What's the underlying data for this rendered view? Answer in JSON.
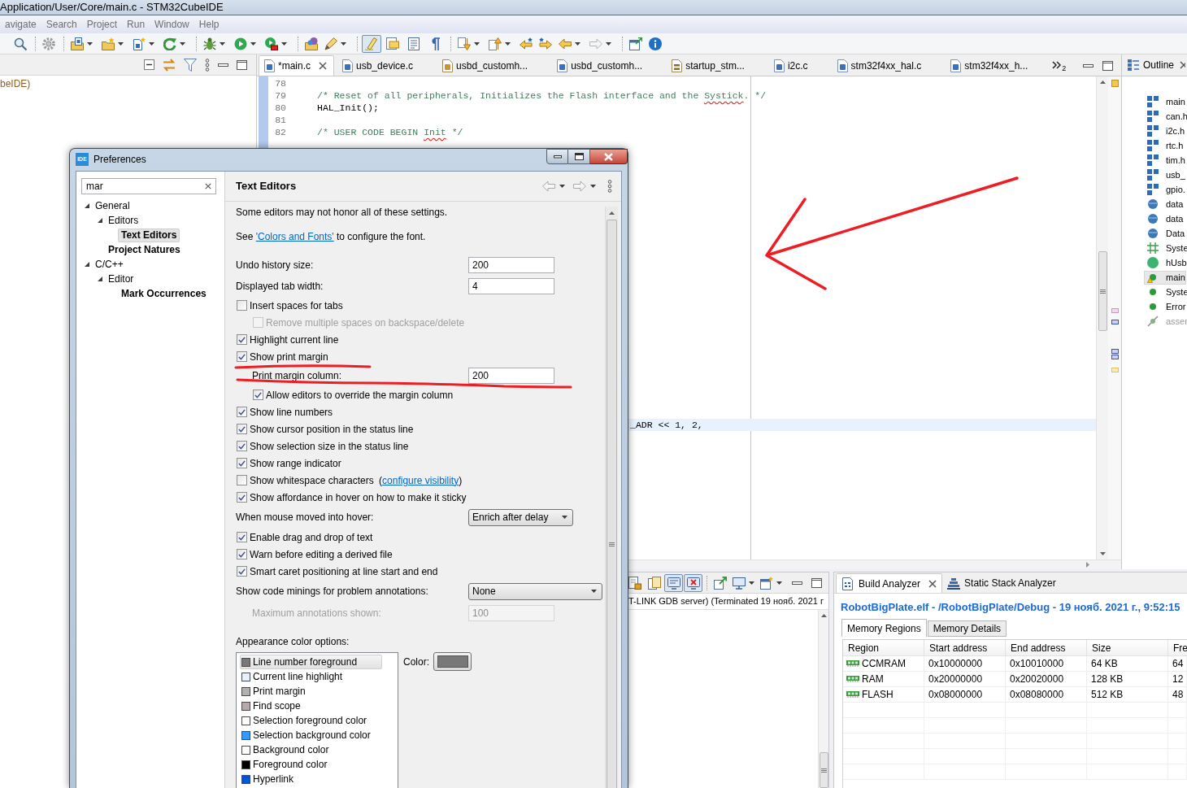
{
  "window": {
    "title": "Application/User/Core/main.c - STM32CubeIDE"
  },
  "menu": [
    "avigate",
    "Search",
    "Project",
    "Run",
    "Window",
    "Help"
  ],
  "toolbar": {
    "toggles": [
      {
        "pressed": true
      },
      {
        "pressed": false
      },
      {
        "pressed": false
      },
      {
        "pressed": false
      }
    ]
  },
  "explorer": {
    "items": [
      "beIDE)"
    ]
  },
  "editor": {
    "tabs": [
      {
        "label": "*main.c",
        "kind": "source",
        "selected": true
      },
      {
        "label": "usb_device.c",
        "kind": "source",
        "selected": false
      },
      {
        "label": "usbd_customh...",
        "kind": "header",
        "selected": false
      },
      {
        "label": "usbd_customh...",
        "kind": "source",
        "selected": false
      },
      {
        "label": "startup_stm...",
        "kind": "assembly",
        "selected": false
      },
      {
        "label": "i2c.c",
        "kind": "source",
        "selected": false
      },
      {
        "label": "stm32f4xx_hal.c",
        "kind": "source",
        "selected": false
      },
      {
        "label": "stm32f4xx_h...",
        "kind": "source",
        "selected": false
      }
    ],
    "hidden_tabs": "2",
    "lines": [
      {
        "number": "78"
      },
      {
        "number": "79",
        "kind": "comment",
        "parts": [
          {
            "text": "/* Reset of all peripherals, Initializes the Flash interface and the ",
            "misspelled": false
          },
          {
            "text": "Systick",
            "misspelled": true
          },
          {
            "text": ". */",
            "misspelled": false
          }
        ]
      },
      {
        "number": "80",
        "kind": "code",
        "parts": [
          {
            "text": "HAL_Init();",
            "misspelled": false
          }
        ]
      },
      {
        "number": "81"
      },
      {
        "number": "82",
        "kind": "comment",
        "parts": [
          {
            "text": "/* USER CODE BEGIN ",
            "misspelled": false
          },
          {
            "text": "Init",
            "misspelled": true
          },
          {
            "text": " */",
            "misspelled": false
          }
        ]
      }
    ],
    "current_line": {
      "text": "_ADR << 1, 2,"
    }
  },
  "outline": {
    "title": "Outline",
    "items": [
      {
        "label": "main",
        "kind": "include",
        "selected": false,
        "warning": false
      },
      {
        "label": "can.h",
        "kind": "include",
        "selected": false,
        "warning": false
      },
      {
        "label": "i2c.h",
        "kind": "include",
        "selected": false,
        "warning": false
      },
      {
        "label": "rtc.h",
        "kind": "include",
        "selected": false,
        "warning": false
      },
      {
        "label": "tim.h",
        "kind": "include",
        "selected": false,
        "warning": false
      },
      {
        "label": "usb_",
        "kind": "include",
        "selected": false,
        "warning": false
      },
      {
        "label": "gpio.",
        "kind": "include",
        "selected": false,
        "warning": false
      },
      {
        "label": "data",
        "kind": "field",
        "selected": false,
        "warning": false
      },
      {
        "label": "data",
        "kind": "field",
        "selected": false,
        "warning": false
      },
      {
        "label": "Data",
        "kind": "field",
        "selected": false,
        "warning": false
      },
      {
        "label": "Syste",
        "kind": "typedef",
        "selected": false,
        "warning": false
      },
      {
        "label": "hUsb",
        "kind": "variable",
        "selected": false,
        "warning": false
      },
      {
        "label": "main",
        "kind": "function",
        "selected": true,
        "warning": true
      },
      {
        "label": "Syste",
        "kind": "function",
        "selected": false,
        "warning": false
      },
      {
        "label": "Error",
        "kind": "function",
        "selected": false,
        "warning": false
      },
      {
        "label": "asser",
        "kind": "macro",
        "selected": false,
        "warning": false
      }
    ]
  },
  "console": {
    "toggles": [
      {
        "pressed": false
      },
      {
        "pressed": false
      },
      {
        "pressed": true
      },
      {
        "pressed": true
      }
    ],
    "description": "T-LINK GDB server) (Terminated 19 нояб. 2021 г"
  },
  "build_analyzer": {
    "tabs": [
      {
        "label": "Build Analyzer",
        "selected": true
      },
      {
        "label": "Static Stack Analyzer",
        "selected": false
      }
    ],
    "heading": "RobotBigPlate.elf - /RobotBigPlate/Debug - 19 нояб. 2021 г., 9:52:15",
    "subtabs": [
      {
        "label": "Memory Regions",
        "selected": true
      },
      {
        "label": "Memory Details",
        "selected": false
      }
    ],
    "table": {
      "columns": [
        "Region",
        "Start address",
        "End address",
        "Size",
        "Fre"
      ],
      "rows": [
        [
          "CCMRAM",
          "0x10000000",
          "0x10010000",
          "64 KB",
          "64"
        ],
        [
          "RAM",
          "0x20000000",
          "0x20020000",
          "128 KB",
          "12"
        ],
        [
          "FLASH",
          "0x08000000",
          "0x08080000",
          "512 KB",
          "48"
        ]
      ]
    }
  },
  "preferences": {
    "icon_label": "IDE",
    "title": "Preferences",
    "filter": "mar",
    "tree": [
      {
        "label": "General",
        "expanded": true,
        "selected": false,
        "match": false,
        "children": [
          {
            "label": "Editors",
            "expanded": true,
            "selected": false,
            "match": false,
            "children": [
              {
                "label": "Text Editors",
                "selected": true,
                "match": true
              }
            ]
          },
          {
            "label": "Project Natures",
            "selected": false,
            "match": true
          }
        ]
      },
      {
        "label": "C/C++",
        "expanded": true,
        "selected": false,
        "match": false,
        "children": [
          {
            "label": "Editor",
            "expanded": true,
            "selected": false,
            "match": false,
            "children": [
              {
                "label": "Mark Occurrences",
                "selected": false,
                "match": true
              }
            ]
          }
        ]
      }
    ],
    "page_title": "Text Editors",
    "settings": [
      {
        "kind": "note",
        "text": "Some editors may not honor all of these settings."
      },
      {
        "kind": "link_note",
        "before": "See ",
        "link": "'Colors and Fonts'",
        "after": " to configure the font."
      },
      {
        "kind": "field",
        "label": "Undo history size:",
        "value": "200",
        "disabled": false
      },
      {
        "kind": "field",
        "label": "Displayed tab width:",
        "value": "4",
        "disabled": false
      },
      {
        "kind": "checkbox",
        "label": "Insert spaces for tabs",
        "checked": false,
        "disabled": false,
        "children": [
          {
            "kind": "checkbox",
            "label": "Remove multiple spaces on backspace/delete",
            "checked": false,
            "disabled": true
          }
        ]
      },
      {
        "kind": "checkbox",
        "label": "Highlight current line",
        "checked": true,
        "disabled": false
      },
      {
        "kind": "checkbox",
        "label": "Show print margin",
        "checked": true,
        "disabled": false,
        "children": [
          {
            "kind": "field",
            "label": "Print margin column:",
            "value": "200",
            "disabled": false
          },
          {
            "kind": "checkbox",
            "label": "Allow editors to override the margin column",
            "checked": true,
            "disabled": false
          }
        ]
      },
      {
        "kind": "checkbox",
        "label": "Show line numbers",
        "checked": true,
        "disabled": false
      },
      {
        "kind": "checkbox",
        "label": "Show cursor position in the status line",
        "checked": true,
        "disabled": false
      },
      {
        "kind": "checkbox",
        "label": "Show selection size in the status line",
        "checked": true,
        "disabled": false
      },
      {
        "kind": "checkbox",
        "label": "Show range indicator",
        "checked": true,
        "disabled": false
      },
      {
        "kind": "checkbox",
        "label": "Show whitespace characters",
        "checked": false,
        "disabled": false,
        "link_open": "(",
        "link": "configure visibility",
        "link_close": ")"
      },
      {
        "kind": "checkbox",
        "label": "Show affordance in hover on how to make it sticky",
        "checked": true,
        "disabled": false
      },
      {
        "kind": "combo",
        "label": "When mouse moved into hover:",
        "value": "Enrich after delay",
        "disabled": false
      },
      {
        "kind": "checkbox",
        "label": "Enable drag and drop of text",
        "checked": true,
        "disabled": false
      },
      {
        "kind": "checkbox",
        "label": "Warn before editing a derived file",
        "checked": true,
        "disabled": false
      },
      {
        "kind": "checkbox",
        "label": "Smart caret positioning at line start and end",
        "checked": true,
        "disabled": false
      },
      {
        "kind": "combo",
        "label": "Show code minings for problem annotations:",
        "value": "None",
        "disabled": false,
        "children": [
          {
            "kind": "field",
            "label": "Maximum annotations shown:",
            "value": "100",
            "disabled": true
          }
        ]
      }
    ],
    "appearance": {
      "label": "Appearance color options:",
      "items": [
        {
          "label": "Line number foreground",
          "color": "#787878",
          "selected": true
        },
        {
          "label": "Current line highlight",
          "color": "#e8f2fe",
          "selected": false
        },
        {
          "label": "Print margin",
          "color": "#b0b0b0",
          "selected": false
        },
        {
          "label": "Find scope",
          "color": "#b4aaaa",
          "selected": false
        },
        {
          "label": "Selection foreground color",
          "color": "#ffffff",
          "selected": false
        },
        {
          "label": "Selection background color",
          "color": "#3399ff",
          "selected": false
        },
        {
          "label": "Background color",
          "color": "#ffffff",
          "selected": false
        },
        {
          "label": "Foreground color",
          "color": "#000000",
          "selected": false
        },
        {
          "label": "Hyperlink",
          "color": "#0055cc",
          "selected": false
        }
      ],
      "color_label": "Color:"
    }
  }
}
